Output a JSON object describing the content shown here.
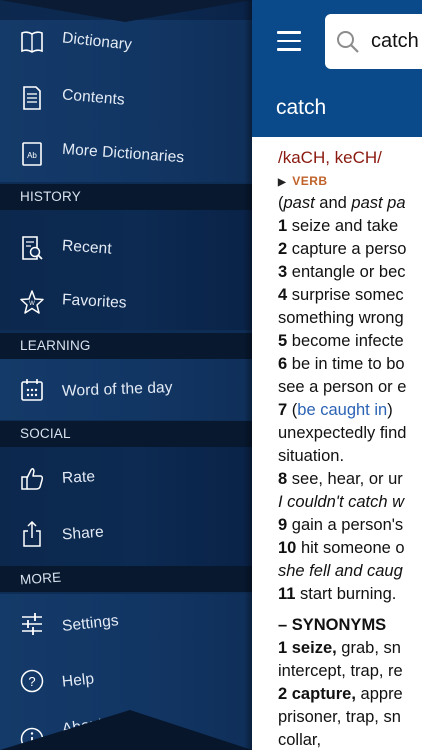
{
  "sidebar": {
    "items_top": [
      {
        "id": "dictionary",
        "label": "Dictionary",
        "icon": "book-icon"
      },
      {
        "id": "contents",
        "label": "Contents",
        "icon": "document-icon"
      },
      {
        "id": "more-dictionaries",
        "label": "More Dictionaries",
        "icon": "dictionary-ab-icon"
      }
    ],
    "sections": [
      {
        "title": "HISTORY",
        "items": [
          {
            "id": "recent",
            "label": "Recent",
            "icon": "recent-search-icon"
          },
          {
            "id": "favorites",
            "label": "Favorites",
            "icon": "star-icon"
          }
        ]
      },
      {
        "title": "LEARNING",
        "items": [
          {
            "id": "word-of-the-day",
            "label": "Word of the day",
            "icon": "calendar-icon"
          }
        ]
      },
      {
        "title": "SOCIAL",
        "items": [
          {
            "id": "rate",
            "label": "Rate",
            "icon": "thumbs-up-icon"
          },
          {
            "id": "share",
            "label": "Share",
            "icon": "share-icon"
          }
        ]
      },
      {
        "title": "MORE",
        "items": [
          {
            "id": "settings",
            "label": "Settings",
            "icon": "sliders-icon"
          },
          {
            "id": "help",
            "label": "Help",
            "icon": "help-icon"
          },
          {
            "id": "about",
            "label": "About",
            "icon": "info-icon"
          }
        ]
      }
    ]
  },
  "header": {
    "search_value": "catch",
    "title": "catch"
  },
  "entry": {
    "pronunciation": "/kaCH, keCH/",
    "part_of_speech": "VERB",
    "lines": [
      {
        "seg": [
          {
            "t": "(",
            "s": ""
          },
          {
            "t": "past",
            "s": "em"
          },
          {
            "t": " and ",
            "s": ""
          },
          {
            "t": "past pa",
            "s": "em"
          }
        ]
      },
      {
        "seg": [
          {
            "t": "1",
            "s": "b"
          },
          {
            "t": " seize and take",
            "s": ""
          }
        ]
      },
      {
        "seg": [
          {
            "t": "2",
            "s": "b"
          },
          {
            "t": " capture a perso",
            "s": ""
          }
        ]
      },
      {
        "seg": [
          {
            "t": "3",
            "s": "b"
          },
          {
            "t": " entangle or bec",
            "s": ""
          }
        ]
      },
      {
        "seg": [
          {
            "t": "4",
            "s": "b"
          },
          {
            "t": " surprise somec",
            "s": ""
          }
        ]
      },
      {
        "seg": [
          {
            "t": "something wrong",
            "s": ""
          }
        ]
      },
      {
        "seg": [
          {
            "t": "5",
            "s": "b"
          },
          {
            "t": " become infecte",
            "s": ""
          }
        ]
      },
      {
        "seg": [
          {
            "t": "6",
            "s": "b"
          },
          {
            "t": " be in time to bo",
            "s": ""
          }
        ]
      },
      {
        "seg": [
          {
            "t": "see a person or e",
            "s": ""
          }
        ]
      },
      {
        "seg": [
          {
            "t": "7",
            "s": "b"
          },
          {
            "t": " (",
            "s": ""
          },
          {
            "t": "be caught in",
            "s": "link"
          },
          {
            "t": ")",
            "s": ""
          }
        ]
      },
      {
        "seg": [
          {
            "t": "unexpectedly find",
            "s": ""
          }
        ]
      },
      {
        "seg": [
          {
            "t": "situation.",
            "s": ""
          }
        ]
      },
      {
        "seg": [
          {
            "t": "8",
            "s": "b"
          },
          {
            "t": " see, hear, or ur",
            "s": ""
          }
        ]
      },
      {
        "seg": [
          {
            "t": " I couldn't catch w",
            "s": "em"
          }
        ]
      },
      {
        "seg": [
          {
            "t": "9",
            "s": "b"
          },
          {
            "t": " gain a person's",
            "s": ""
          }
        ]
      },
      {
        "seg": [
          {
            "t": "10",
            "s": "b"
          },
          {
            "t": " hit someone o",
            "s": ""
          }
        ]
      },
      {
        "seg": [
          {
            "t": " she fell and caug",
            "s": "em"
          }
        ]
      },
      {
        "seg": [
          {
            "t": "11",
            "s": "b"
          },
          {
            "t": " start burning.",
            "s": ""
          }
        ]
      }
    ],
    "synonyms_header": "– SYNONYMS",
    "synonym_lines": [
      {
        "seg": [
          {
            "t": "1 seize,",
            "s": "b"
          },
          {
            "t": " grab, sn",
            "s": ""
          }
        ]
      },
      {
        "seg": [
          {
            "t": "intercept, trap, re",
            "s": ""
          }
        ]
      },
      {
        "seg": [
          {
            "t": "2 capture,",
            "s": "b"
          },
          {
            "t": " appre",
            "s": ""
          }
        ]
      },
      {
        "seg": [
          {
            "t": "prisoner, trap, sn",
            "s": ""
          }
        ]
      },
      {
        "seg": [
          {
            "t": "collar,",
            "s": ""
          }
        ]
      }
    ]
  },
  "colors": {
    "header_blue": "#0b4a8a",
    "sidebar_navy": "#0e2d55",
    "pronunciation_red": "#8a1a10",
    "pos_orange": "#c0622a",
    "link_blue": "#2c63b5"
  }
}
